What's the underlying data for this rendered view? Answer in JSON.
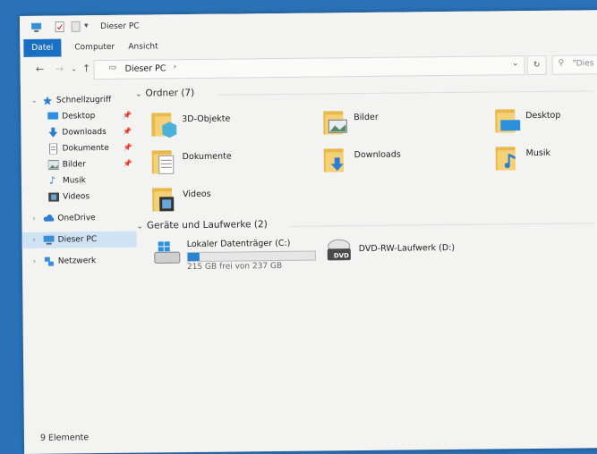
{
  "window": {
    "title": "Dieser PC"
  },
  "ribbon": {
    "tabs": [
      "Datei",
      "Computer",
      "Ansicht"
    ]
  },
  "address": {
    "path": "Dieser PC",
    "search_placeholder": "\"Dies"
  },
  "sidebar": {
    "quick_access": "Schnellzugriff",
    "quick_items": [
      "Desktop",
      "Downloads",
      "Dokumente",
      "Bilder",
      "Musik",
      "Videos"
    ],
    "onedrive": "OneDrive",
    "this_pc": "Dieser PC",
    "network": "Netzwerk"
  },
  "folders": {
    "header": "Ordner (7)",
    "items": [
      "3D-Objekte",
      "Bilder",
      "Desktop",
      "Dokumente",
      "Downloads",
      "Musik",
      "Videos"
    ]
  },
  "drives": {
    "header": "Geräte und Laufwerke (2)",
    "c": {
      "name": "Lokaler Datenträger (C:)",
      "free_text": "215 GB frei von 237 GB",
      "used_fraction": 0.09
    },
    "d": {
      "name": "DVD-RW-Laufwerk (D:)",
      "badge": "DVD"
    }
  },
  "status": {
    "count": "9 Elemente"
  },
  "colors": {
    "accent": "#1b6fc2",
    "selection": "#cfe3f5",
    "progress": "#2683d6",
    "folder": "#e8b94a"
  }
}
